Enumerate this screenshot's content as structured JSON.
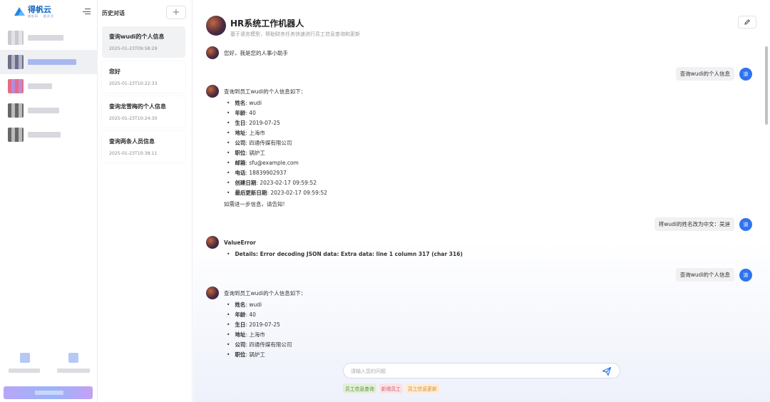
{
  "app": {
    "logo_text": "得帆云",
    "logo_sub": "超低码 · 超灵活"
  },
  "history": {
    "title": "历史对话",
    "add_label": "+",
    "items": [
      {
        "name": "查询wudi的个人信息",
        "date": "2025-01-23T09:58:29"
      },
      {
        "name": "您好",
        "date": "2025-01-23T10:22:33"
      },
      {
        "name": "查询龙雪梅的个人信息",
        "date": "2025-01-23T10:24:30"
      },
      {
        "name": "查询两条人员信息",
        "date": "2025-01-23T10:38:11"
      }
    ]
  },
  "main": {
    "title": "HR系统工作机器人",
    "subtitle": "基于语言模型，帮助财务任务快速进行员工信息查询和更新"
  },
  "user_avatar_text": "迪",
  "messages": {
    "greeting": "您好，我是您的人事小助手",
    "user_q1": "查询wudi的个人信息",
    "info_intro": "查询到员工wudi的个人信息如下：",
    "fields": [
      {
        "label": "姓名",
        "value": "wudi"
      },
      {
        "label": "年龄",
        "value": "40"
      },
      {
        "label": "生日",
        "value": "2019-07-25"
      },
      {
        "label": "地址",
        "value": "上海市"
      },
      {
        "label": "公司",
        "value": "四通传媒有限公司"
      },
      {
        "label": "职位",
        "value": "锅炉工"
      },
      {
        "label": "邮箱",
        "value": "sfu@example.com"
      },
      {
        "label": "电话",
        "value": "18839902937"
      },
      {
        "label": "创建日期",
        "value": "2023-02-17 09:59:52"
      },
      {
        "label": "最后更新日期",
        "value": "2023-02-17 09:59:52"
      }
    ],
    "info_outro": "如需进一步信息，请告知!",
    "user_q2": "将wudi的姓名改为中文：吴迪",
    "error_title": "ValueError",
    "error_detail": "Details: Error decoding JSON data: Extra data: line 1 column 317 (char 316)",
    "user_q3": "查询wudi的个人信息",
    "info_intro2": "查询到员工wudi的个人信息如下："
  },
  "input": {
    "placeholder": "请输入您的问题",
    "value": ""
  },
  "chips": [
    "员工信息查询",
    "新增员工",
    "员工信息更新"
  ],
  "colors": {
    "accent": "#2f74ee",
    "logo": "#1565c0",
    "chip_green": "#5d8a36",
    "chip_red": "#d2566b",
    "chip_orange": "#d58c2b"
  }
}
